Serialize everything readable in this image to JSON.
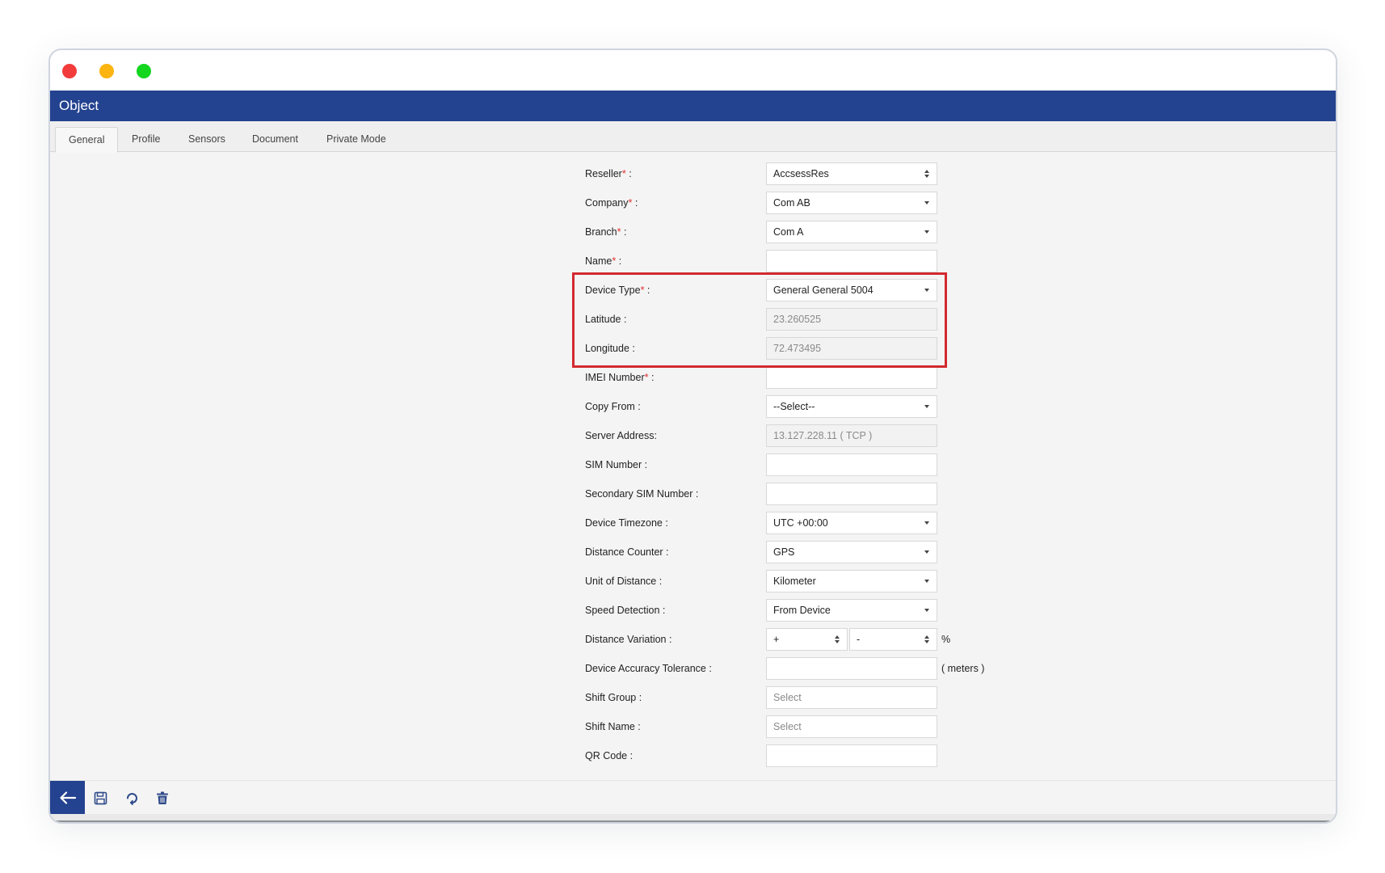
{
  "window": {
    "controls": [
      "close",
      "minimize",
      "maximize"
    ]
  },
  "header": {
    "title": "Object"
  },
  "tabs": [
    {
      "label": "General",
      "active": true
    },
    {
      "label": "Profile",
      "active": false
    },
    {
      "label": "Sensors",
      "active": false
    },
    {
      "label": "Document",
      "active": false
    },
    {
      "label": "Private Mode",
      "active": false
    }
  ],
  "form": {
    "reseller": {
      "label": "Reseller",
      "required": "*",
      "colon": " :",
      "value": "AccsessRes",
      "control": "select-updown"
    },
    "company": {
      "label": "Company",
      "required": "*",
      "colon": " :",
      "value": "Com AB",
      "control": "select"
    },
    "branch": {
      "label": "Branch",
      "required": "*",
      "colon": " :",
      "value": "Com A",
      "control": "select"
    },
    "name": {
      "label": "Name",
      "required": "*",
      "colon": " :",
      "value": "",
      "control": "text"
    },
    "device_type": {
      "label": "Device Type",
      "required": "*",
      "colon": " :",
      "value": "General General 5004",
      "control": "select"
    },
    "latitude": {
      "label": "Latitude :",
      "value": "23.260525",
      "control": "text-disabled"
    },
    "longitude": {
      "label": "Longitude :",
      "value": "72.473495",
      "control": "text-disabled"
    },
    "imei": {
      "label": "IMEI Number",
      "required": "*",
      "colon": " :",
      "value": "",
      "control": "text"
    },
    "copy_from": {
      "label": "Copy From :",
      "value": "--Select--",
      "control": "select"
    },
    "server_address": {
      "label": "Server Address:",
      "value": "13.127.228.11 ( TCP )",
      "control": "text-disabled"
    },
    "sim_number": {
      "label": "SIM Number :",
      "value": "",
      "control": "text"
    },
    "secondary_sim": {
      "label": "Secondary SIM Number :",
      "value": "",
      "control": "text"
    },
    "device_timezone": {
      "label": "Device Timezone :",
      "value": "UTC +00:00",
      "control": "select"
    },
    "distance_counter": {
      "label": "Distance Counter :",
      "value": "GPS",
      "control": "select"
    },
    "unit_of_distance": {
      "label": "Unit of Distance :",
      "value": "Kilometer",
      "control": "select"
    },
    "speed_detection": {
      "label": "Speed Detection :",
      "value": "From Device",
      "control": "select"
    },
    "distance_variation": {
      "label": "Distance Variation :",
      "sign_value": "+",
      "amount_value": "-",
      "suffix": "%"
    },
    "device_accuracy": {
      "label": "Device Accuracy Tolerance :",
      "value": "",
      "suffix": "( meters )"
    },
    "shift_group": {
      "label": "Shift Group :",
      "placeholder": "Select"
    },
    "shift_name": {
      "label": "Shift Name :",
      "placeholder": "Select"
    },
    "qr_code": {
      "label": "QR Code :",
      "value": ""
    }
  },
  "highlight": {
    "color": "#d22a2f",
    "covers": [
      "device_type",
      "latitude",
      "longitude"
    ]
  },
  "toolbar": {
    "back": "arrow-left-icon",
    "save": "save-icon",
    "refresh": "refresh-icon",
    "delete": "trash-icon"
  },
  "colors": {
    "brand": "#23428f",
    "required": "#e03030",
    "close": "#f23b3b",
    "minimize": "#fbb410",
    "maximize": "#13d61f"
  }
}
